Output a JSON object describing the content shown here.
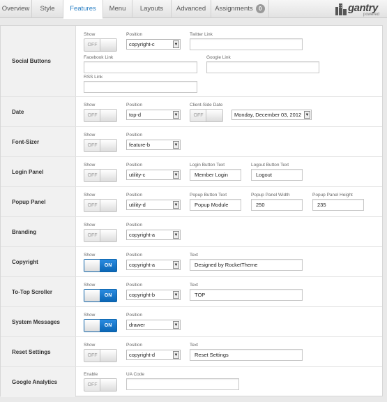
{
  "tabs": [
    {
      "label": "Overview"
    },
    {
      "label": "Style"
    },
    {
      "label": "Features"
    },
    {
      "label": "Menu"
    },
    {
      "label": "Layouts"
    },
    {
      "label": "Advanced"
    },
    {
      "label": "Assignments",
      "badge": "0"
    }
  ],
  "logo": {
    "word": "gantry",
    "sub": "powered"
  },
  "captions": {
    "show": "Show",
    "position": "Position",
    "text": "Text",
    "enable": "Enable",
    "twitter": "Twitter Link",
    "facebook": "Facebook Link",
    "google": "Google Link",
    "rss": "RSS Link",
    "client_date": "Client-Side Date",
    "login_text": "Login Button Text",
    "logout_text": "Logout Button Text",
    "popup_text": "Popup Button Text",
    "popup_width": "Popup Panel Width",
    "popup_height": "Popup Panel Height",
    "ua_code": "UA Code"
  },
  "toggle": {
    "off": "OFF",
    "on": "ON"
  },
  "rows": {
    "social": {
      "label": "Social Buttons",
      "show": "off",
      "position": "copyright-c",
      "twitter": "",
      "facebook": "",
      "google": "",
      "rss": ""
    },
    "date": {
      "label": "Date",
      "show": "off",
      "position": "top-d",
      "client_date": "off",
      "format": "Monday, December 03, 2012"
    },
    "fontsizer": {
      "label": "Font-Sizer",
      "show": "off",
      "position": "feature-b"
    },
    "login": {
      "label": "Login Panel",
      "show": "off",
      "position": "utility-c",
      "login_text": "Member Login",
      "logout_text": "Logout"
    },
    "popup": {
      "label": "Popup Panel",
      "show": "off",
      "position": "utility-d",
      "popup_text": "Popup Module",
      "popup_width": "250",
      "popup_height": "235"
    },
    "branding": {
      "label": "Branding",
      "show": "off",
      "position": "copyright-a"
    },
    "copyright": {
      "label": "Copyright",
      "show": "on",
      "position": "copyright-a",
      "text": "Designed by RocketTheme"
    },
    "totop": {
      "label": "To-Top Scroller",
      "show": "on",
      "position": "copyright-b",
      "text": "TOP"
    },
    "sysmsg": {
      "label": "System Messages",
      "show": "on",
      "position": "drawer"
    },
    "reset": {
      "label": "Reset Settings",
      "show": "off",
      "position": "copyright-d",
      "text": "Reset Settings"
    },
    "analytics": {
      "label": "Google Analytics",
      "enable": "off",
      "ua_code": ""
    }
  }
}
